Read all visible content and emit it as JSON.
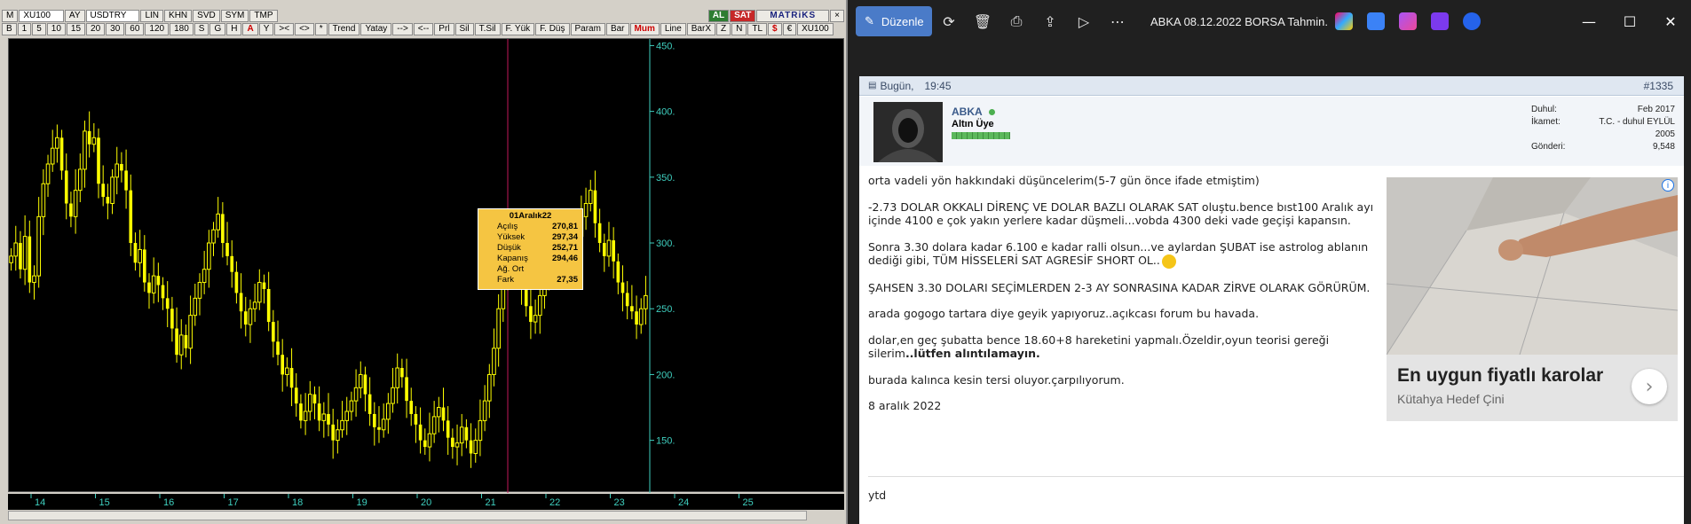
{
  "trading": {
    "toolbar1": [
      "M",
      "XU100",
      "AY",
      "USDTRY",
      "LIN",
      "KHN",
      "SVD",
      "SYM",
      "TMP",
      "AL",
      "SAT",
      "MATRiKS"
    ],
    "toolbar2": [
      "B",
      "1",
      "5",
      "10",
      "15",
      "20",
      "30",
      "60",
      "120",
      "180",
      "S",
      "G",
      "H",
      "A",
      "Y",
      "><",
      "<>",
      "*",
      "Trend",
      "Yatay",
      "-->",
      "<--",
      "Prl",
      "Sil",
      "T.Sil",
      "F. Yük",
      "F. Düş",
      "Param",
      "Bar",
      "Mum",
      "Line",
      "BarX",
      "Z",
      "N",
      "TL",
      "$",
      "€",
      "XU100"
    ],
    "tooltip": {
      "title": "01Aralık22",
      "rows": [
        {
          "k": "Açılış",
          "v": "270,81"
        },
        {
          "k": "Yüksek",
          "v": "297,34"
        },
        {
          "k": "Düşük",
          "v": "252,71"
        },
        {
          "k": "Kapanış",
          "v": "294,46"
        },
        {
          "k": "Ağ. Ort",
          "v": ""
        },
        {
          "k": "Fark",
          "v": "27,35"
        }
      ]
    },
    "colors": {
      "candle": "#ffff00",
      "axis": "#3fd0c0",
      "cursor": "#c2185b"
    }
  },
  "chart_data": {
    "type": "candlestick",
    "y_ticks": [
      "450.",
      "400.",
      "350.",
      "300.",
      "250.",
      "200.",
      "150."
    ],
    "y_tick_values": [
      450,
      400,
      350,
      300,
      250,
      200,
      150
    ],
    "ylim": [
      110,
      455
    ],
    "x_ticks": [
      "14",
      "15",
      "16",
      "17",
      "18",
      "19",
      "20",
      "21",
      "22",
      "23",
      "24",
      "25"
    ],
    "closes": [
      290,
      300,
      280,
      305,
      270,
      275,
      320,
      345,
      360,
      372,
      380,
      355,
      330,
      320,
      340,
      356,
      385,
      375,
      380,
      345,
      335,
      330,
      350,
      360,
      355,
      340,
      300,
      285,
      295,
      270,
      262,
      275,
      268,
      258,
      250,
      235,
      215,
      230,
      220,
      245,
      258,
      270,
      280,
      300,
      310,
      322,
      300,
      290,
      278,
      262,
      248,
      238,
      250,
      255,
      270,
      265,
      240,
      225,
      215,
      200,
      205,
      190,
      178,
      165,
      172,
      185,
      178,
      165,
      170,
      162,
      150,
      158,
      165,
      172,
      180,
      190,
      200,
      185,
      170,
      160,
      158,
      166,
      178,
      190,
      205,
      198,
      180,
      170,
      162,
      150,
      145,
      155,
      168,
      175,
      165,
      152,
      145,
      148,
      160,
      150,
      140,
      150,
      165,
      180,
      200,
      220,
      250,
      270,
      294,
      300,
      280,
      265,
      252,
      240,
      245,
      260,
      270,
      285,
      300,
      305,
      290,
      282,
      295,
      305,
      320,
      330,
      340,
      315,
      300,
      290,
      302,
      286,
      270,
      262,
      252,
      248,
      238,
      250,
      260
    ],
    "highlight_index": 108
  },
  "browser": {
    "edit_label": "Düzenle",
    "window_title": "ABKA 08.12.2022 BORSA Tahmin...",
    "post": {
      "date": "Bugün,",
      "time": "19:45",
      "number": "#1335",
      "user": "ABKA",
      "user_title": "Altın Üye",
      "stats": [
        {
          "k": "Duhul:",
          "v": "Feb 2017"
        },
        {
          "k": "İkamet:",
          "v": "T.C. - duhul EYLÜL 2005"
        },
        {
          "k": "Gönderi:",
          "v": "9,548"
        }
      ],
      "paragraphs": [
        "orta vadeli yön hakkındaki düşüncelerim(5-7 gün önce ifade etmiştim)",
        "-2.73 DOLAR OKKALI DİRENÇ VE DOLAR BAZLI OLARAK SAT oluştu.bence bıst100 Aralık ayı içinde 4100 e çok yakın yerlere kadar düşmeli...vobda 4300 deki vade geçişi kapansın.",
        "Sonra 3.30 dolara kadar 6.100 e kadar ralli olsun...ve aylardan ŞUBAT ise astrolog ablanın dediği gibi, TÜM HİSSELERİ SAT AGRESİF SHORT OL..",
        "ŞAHSEN 3.30 DOLARI SEÇİMLERDEN 2-3 AY SONRASINA KADAR ZİRVE OLARAK GÖRÜRÜM.",
        "arada gogogo tartara diye geyik yapıyoruz..açıkcası forum bu havada."
      ],
      "p6_text": "dolar,en geç şubatta bence 18.60+8 hareketini yapmalı.Özeldir,oyun teorisi gereği silerim",
      "p6_bold": "..lütfen alıntılamayın.",
      "p7": "burada kalınca kesin tersi oluyor.çarpılıyorum.",
      "p8": "8 aralık 2022",
      "next": "ytd"
    },
    "ad": {
      "title": "En uygun fiyatlı karolar",
      "sub": "Kütahya Hedef Çini"
    }
  }
}
